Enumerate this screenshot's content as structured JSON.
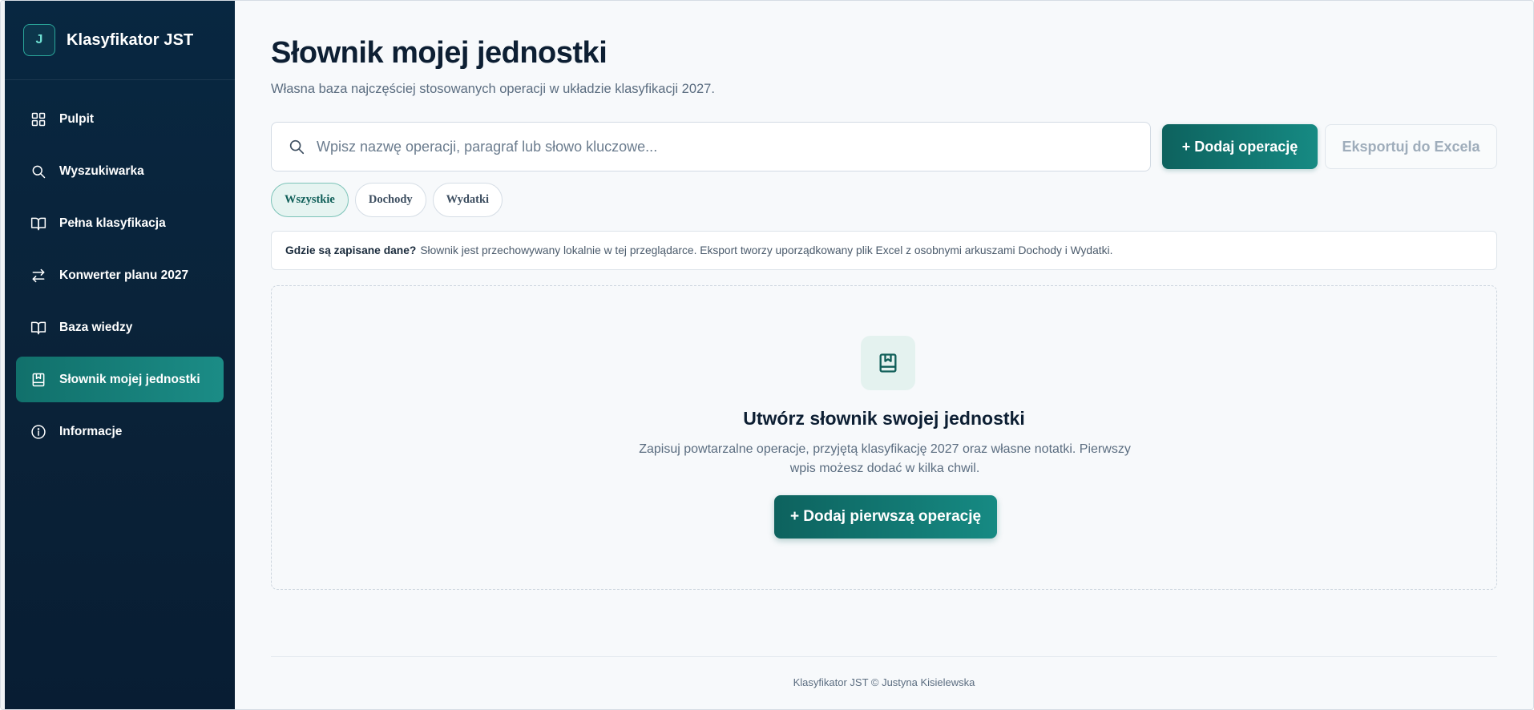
{
  "brand": {
    "logo_letter": "J",
    "name": "Klasyfikator JST"
  },
  "sidebar": {
    "items": [
      {
        "label": "Pulpit",
        "icon": "grid-icon",
        "active": false
      },
      {
        "label": "Wyszukiwarka",
        "icon": "search-icon",
        "active": false
      },
      {
        "label": "Pełna klasyfikacja",
        "icon": "book-open-icon",
        "active": false
      },
      {
        "label": "Konwerter planu 2027",
        "icon": "arrows-left-right-icon",
        "active": false
      },
      {
        "label": "Baza wiedzy",
        "icon": "book-open-icon",
        "active": false
      },
      {
        "label": "Słownik mojej jednostki",
        "icon": "bookmark-book-icon",
        "active": true
      },
      {
        "label": "Informacje",
        "icon": "info-circle-icon",
        "active": false
      }
    ]
  },
  "page": {
    "title": "Słownik mojej jednostki",
    "subtitle": "Własna baza najczęściej stosowanych operacji w układzie klasyfikacji 2027."
  },
  "search": {
    "placeholder": "Wpisz nazwę operacji, paragraf lub słowo kluczowe...",
    "value": ""
  },
  "actions": {
    "add_label": "+ Dodaj operację",
    "export_label": "Eksportuj do Excela"
  },
  "filters": [
    {
      "label": "Wszystkie",
      "active": true
    },
    {
      "label": "Dochody",
      "active": false
    },
    {
      "label": "Wydatki",
      "active": false
    }
  ],
  "info": {
    "question": "Gdzie są zapisane dane?",
    "text": "Słownik jest przechowywany lokalnie w tej przeglądarce. Eksport tworzy uporządkowany plik Excel z osobnymi arkuszami Dochody i Wydatki."
  },
  "empty_state": {
    "icon": "bookmark-book-icon",
    "title": "Utwórz słownik swojej jednostki",
    "text": "Zapisuj powtarzalne operacje, przyjętą klasyfikację 2027 oraz własne notatki. Pierwszy wpis możesz dodać w kilka chwil.",
    "button_label": "+ Dodaj pierwszą operację"
  },
  "footer": {
    "text": "Klasyfikator JST © Justyna Kisielewska"
  },
  "colors": {
    "sidebar_bg": "#082741",
    "accent": "#168a83",
    "accent_dark": "#0d625e",
    "title": "#0d1f33",
    "muted": "#5b6d80"
  }
}
